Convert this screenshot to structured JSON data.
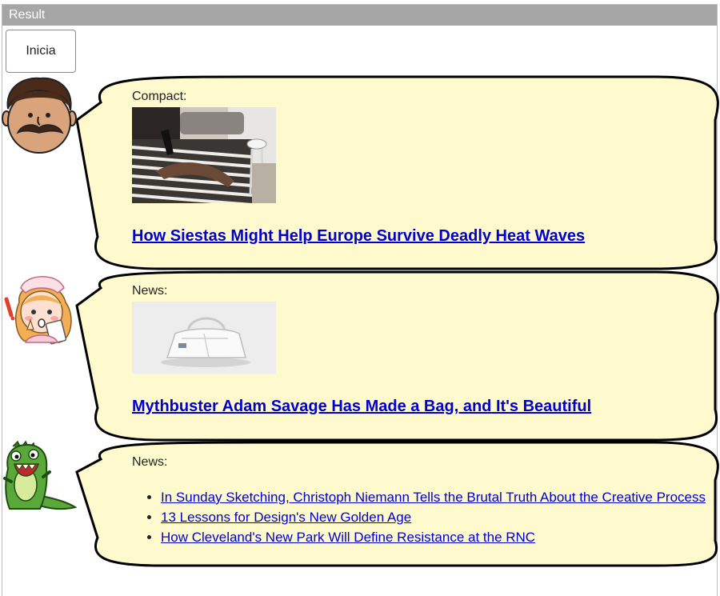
{
  "window": {
    "title": "Result"
  },
  "controls": {
    "start_label": "Inicia"
  },
  "messages": [
    {
      "speaker": "man-with-mustache",
      "kind": "Compact:",
      "image": "woman-lying-on-bed-photo",
      "headline": "How Siestas Might Help Europe Survive Deadly Heat Waves"
    },
    {
      "speaker": "nurse-girl",
      "kind": "News:",
      "image": "white-bag-photo",
      "headline": "Mythbuster Adam Savage Has Made a Bag, and It's Beautiful"
    },
    {
      "speaker": "green-dinosaur",
      "kind": "News:",
      "links": [
        "In Sunday Sketching, Christoph Niemann Tells the Brutal Truth About the Creative Process",
        "13 Lessons for Design's New Golden Age",
        "How Cleveland's New Park Will Define Resistance at the RNC"
      ]
    }
  ],
  "colors": {
    "titlebar": "#a6a6a6",
    "bubble_fill": "#fffacd",
    "bubble_stroke": "#000000",
    "link": "#0000cc"
  }
}
